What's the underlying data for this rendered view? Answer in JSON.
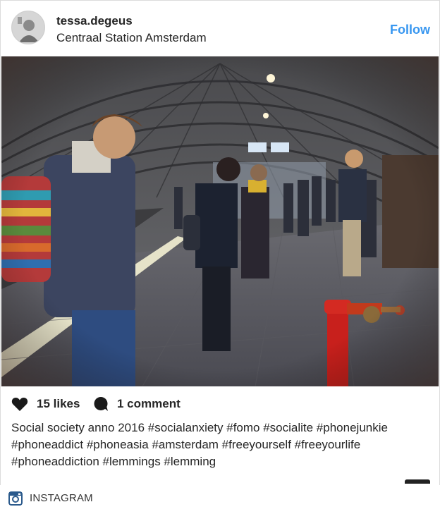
{
  "post": {
    "username": "tessa.degeus",
    "location": "Centraal Station Amsterdam",
    "follow_label": "Follow"
  },
  "actions": {
    "likes_label": "15 likes",
    "comments_label": "1 comment"
  },
  "caption": {
    "text": "Social society anno 2016 #socialanxiety #fomo #socialite #phonejunkie #phoneaddict #phoneasia #amsterdam #freeyourself #freeyourlife #phoneaddiction #lemmings #lemming"
  },
  "footer": {
    "label": "INSTAGRAM"
  },
  "icons": {
    "heart": "heart-icon",
    "comment": "comment-bubble-icon",
    "instagram": "instagram-logo-icon"
  },
  "colors": {
    "follow": "#3897f0",
    "text": "#262626",
    "hydrant": "#c8201c"
  }
}
